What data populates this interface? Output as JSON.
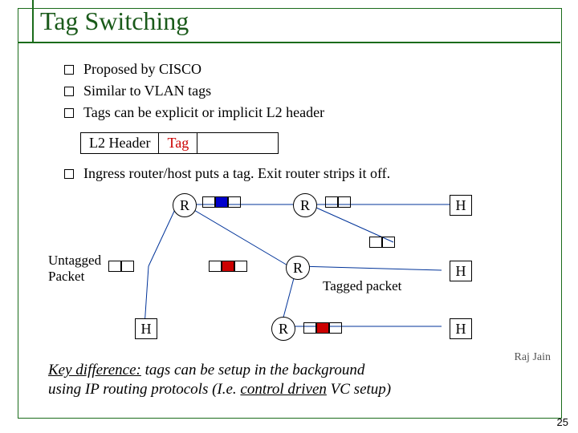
{
  "title": "Tag Switching",
  "bullets": [
    "Proposed by CISCO",
    "Similar to VLAN tags",
    "Tags can be explicit or implicit L2 header"
  ],
  "l2box": {
    "header": "L2 Header",
    "tag": "Tag"
  },
  "bullet4": "Ingress router/host puts a tag. Exit router strips it off.",
  "diagram": {
    "labels": {
      "untagged_packet_line1": "Untagged",
      "untagged_packet_line2": "Packet",
      "tagged_packet": "Tagged packet"
    },
    "nodes": {
      "R": "R",
      "H": "H"
    }
  },
  "keydiff": {
    "label": "Key difference:",
    "rest1": " tags can be setup in the background",
    "rest2a": "using IP routing protocols (I.e. ",
    "ctrl": "control driven",
    "rest2b": " VC setup)"
  },
  "attribution": "Raj Jain",
  "page": "25"
}
